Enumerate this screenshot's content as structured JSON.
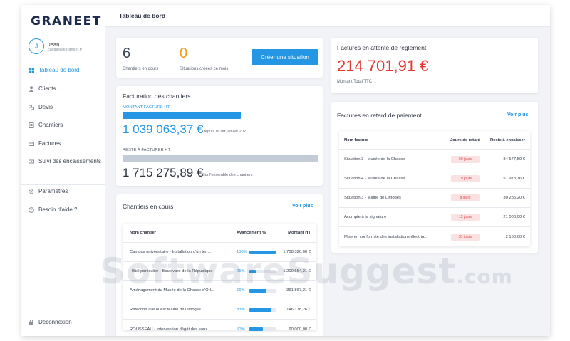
{
  "app": {
    "logo": "GRANEET"
  },
  "user": {
    "initial": "J",
    "name": "Jean",
    "email": "cavalier@graneet.fr"
  },
  "sidebar": {
    "items": [
      {
        "label": "Tableau de bord",
        "icon": "dashboard-icon"
      },
      {
        "label": "Clients",
        "icon": "user-icon"
      },
      {
        "label": "Devis",
        "icon": "quote-icon"
      },
      {
        "label": "Chantiers",
        "icon": "building-icon"
      },
      {
        "label": "Factures",
        "icon": "invoice-icon"
      },
      {
        "label": "Suivi des encaissements",
        "icon": "cash-icon"
      }
    ],
    "bottom": [
      {
        "label": "Paramètres",
        "icon": "gear-icon"
      },
      {
        "label": "Besoin d'aide ?",
        "icon": "help-icon"
      }
    ],
    "logout": "Déconnexion"
  },
  "header": {
    "title": "Tableau de bord"
  },
  "summary": {
    "chantiers_count": "6",
    "chantiers_label": "Chantiers en cours",
    "situations_count": "0",
    "situations_label": "Situations créées ce mois",
    "create_button": "Créer une situation"
  },
  "facturation": {
    "title": "Facturation des chantiers",
    "facture_label": "MONTANT FACTURÉ HT",
    "facture_amount": "1 039 063,37 €",
    "facture_note": "Depuis le 1er janvier 2021",
    "reste_label": "RESTE À FACTURER HT",
    "reste_amount": "1 715 275,89 €",
    "reste_note": "Sur l'ensemble des chantiers"
  },
  "chantiers": {
    "title": "Chantiers en cours",
    "link": "Voir plus",
    "columns": [
      "Nom chantier",
      "Avancement %",
      "Montant HT"
    ],
    "rows": [
      {
        "name": "Campus universitaire - Installation d'un terr...",
        "pct": "100%",
        "progress": 1.0,
        "amount": "1 708 320,00 €"
      },
      {
        "name": "Hôtel particulier - Boulevard de la République",
        "pct": "25%",
        "progress": 0.25,
        "amount": "1 200 554,21 €"
      },
      {
        "name": "Aménagement du Musée de la Chasse d'Orl...",
        "pct": "66%",
        "progress": 0.66,
        "amount": "361 867,21 €"
      },
      {
        "name": "Réfection aile ouest Mairie de Limoges",
        "pct": "83%",
        "progress": 0.83,
        "amount": "146 178,26 €"
      },
      {
        "name": "ROUSSEAU - Intervention dégât des eaux",
        "pct": "50%",
        "progress": 0.5,
        "amount": "60 000,00 €"
      }
    ]
  },
  "attente": {
    "title": "Factures en attente de règlement",
    "amount": "214 701,91 €",
    "label": "Montant Total TTC",
    "amount_color": "#e53935"
  },
  "retard": {
    "title": "Factures en retard de paiement",
    "link": "Voir plus",
    "columns": [
      "Nom facture",
      "Jours de retard",
      "Reste à encaisser"
    ],
    "rows": [
      {
        "name": "Situation 3 - Musée de la Chasse",
        "days": "50 jours",
        "amount": "84 577,50 €"
      },
      {
        "name": "Situation 4 - Musée de la Chasse",
        "days": "19 jours",
        "amount": "51 978,16 €"
      },
      {
        "name": "Situation 3 - Mairie de Limoges",
        "days": "8 jours",
        "amount": "30 285,20 €"
      },
      {
        "name": "Acompte à la signature",
        "days": "12 jours",
        "amount": "21 000,00 €"
      },
      {
        "name": "Mise en conformité des installations électriq...",
        "days": "31 jours",
        "amount": "2 160,00 €"
      }
    ]
  },
  "watermark": {
    "main": "SoftwareSuggest",
    "domain": ".com"
  },
  "colors": {
    "accent": "#2496e4",
    "danger": "#e53935",
    "orange": "#f39c12"
  }
}
